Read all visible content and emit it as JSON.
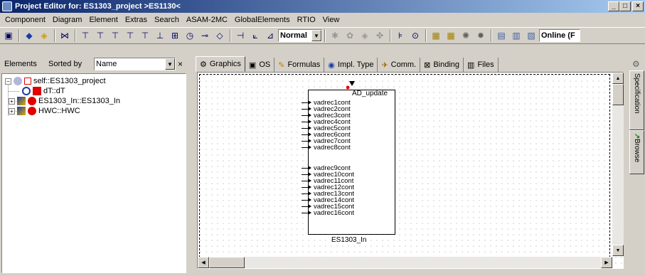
{
  "window": {
    "title": "Project Editor for: ES1303_project >ES1130<",
    "minimize": "_",
    "maximize": "□",
    "close": "×"
  },
  "menu": [
    "Component",
    "Diagram",
    "Element",
    "Extras",
    "Search",
    "ASAM-2MC",
    "GlobalElements",
    "RTIO",
    "View"
  ],
  "toolbar": {
    "mode_select": "Normal",
    "online_select": "Online (F"
  },
  "left_panel": {
    "label": "Elements",
    "sorted_by_label": "Sorted by",
    "sort_value": "Name",
    "close": "×",
    "tree": [
      {
        "label": "self::ES1303_project",
        "level": 0,
        "expander": "−"
      },
      {
        "label": "dT::dT",
        "level": 1,
        "expander": ""
      },
      {
        "label": "ES1303_In::ES1303_In",
        "level": 1,
        "expander": "+"
      },
      {
        "label": "HWC::HWC",
        "level": 1,
        "expander": "+"
      }
    ]
  },
  "tabs": [
    {
      "label": "Graphics",
      "icon": "graphics-icon",
      "active": true
    },
    {
      "label": "OS",
      "icon": "os-icon",
      "active": false
    },
    {
      "label": "Formulas",
      "icon": "formulas-icon",
      "active": false
    },
    {
      "label": "Impl. Type",
      "icon": "impl-type-icon",
      "active": false
    },
    {
      "label": "Comm.",
      "icon": "comm-icon",
      "active": false
    },
    {
      "label": "Binding",
      "icon": "binding-icon",
      "active": false
    },
    {
      "label": "Files",
      "icon": "files-icon",
      "active": false
    }
  ],
  "block": {
    "top_port": "AD_update",
    "name": "ES1303_In",
    "ports_group1": [
      "vadrec1cont",
      "vadrec2cont",
      "vadrec3cont",
      "vadrec4cont",
      "vadrec5cont",
      "vadrec6cont",
      "vadrec7cont",
      "vadrec8cont"
    ],
    "ports_group2": [
      "vadrec9cont",
      "vadrec10cont",
      "vadrec11cont",
      "vadrec12cont",
      "vadrec13cont",
      "vadrec14cont",
      "vadrec15cont",
      "vadrec16cont"
    ]
  },
  "right_sidebar": {
    "specification": "Specification",
    "browse": "Browse"
  },
  "colors": {
    "title_gradient_start": "#0a246a",
    "title_gradient_end": "#a6caf0",
    "face": "#d4d0c8",
    "marker_red": "#e00000"
  }
}
